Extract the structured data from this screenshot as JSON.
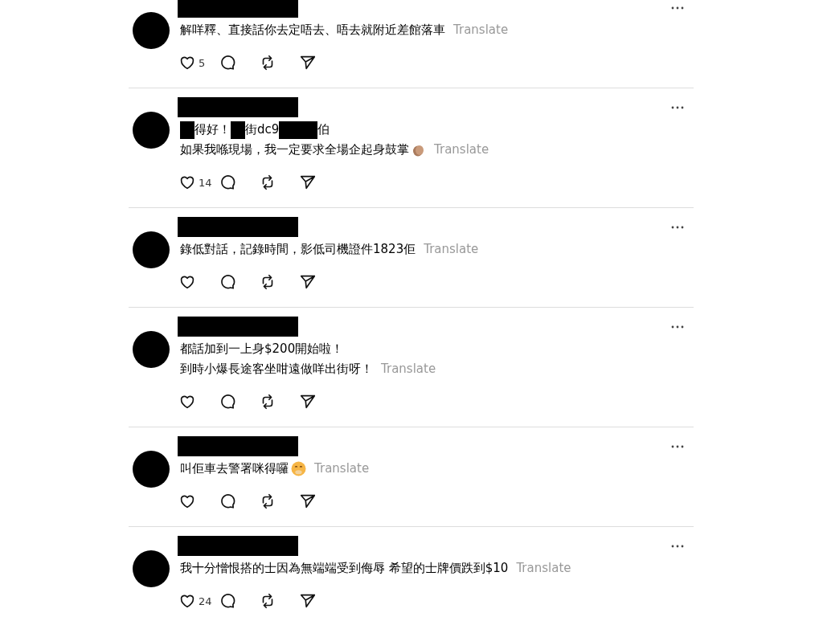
{
  "posts": [
    {
      "lines": [
        [
          {
            "kind": "text",
            "text": "解咩釋、直接話你去定唔去、唔去就附近差館落車"
          }
        ]
      ],
      "translate": "Translate",
      "likes": "5"
    },
    {
      "lines": [
        [
          {
            "kind": "redacted",
            "wide": false
          },
          {
            "kind": "text",
            "text": "得好！"
          },
          {
            "kind": "redacted",
            "wide": false
          },
          {
            "kind": "text",
            "text": "街dc9"
          },
          {
            "kind": "redacted",
            "wide": true
          },
          {
            "kind": "text",
            "text": "伯"
          }
        ],
        [
          {
            "kind": "text",
            "text": "如果我喺現場，我一定要求全場企起身鼓掌"
          },
          {
            "kind": "clap"
          }
        ]
      ],
      "translate": "Translate",
      "likes": "14"
    },
    {
      "lines": [
        [
          {
            "kind": "text",
            "text": "錄低對話，記錄時間，影低司機證件1823佢"
          }
        ]
      ],
      "translate": "Translate"
    },
    {
      "lines": [
        [
          {
            "kind": "text",
            "text": "都話加到一上身$200開始啦！"
          }
        ],
        [
          {
            "kind": "text",
            "text": "到時小爆長途客坐咁遠做咩出街呀！"
          }
        ]
      ],
      "translate": "Translate"
    },
    {
      "lines": [
        [
          {
            "kind": "text",
            "text": "叫佢車去警署咪得囉"
          },
          {
            "kind": "smile"
          }
        ]
      ],
      "translate": "Translate"
    },
    {
      "lines": [
        [
          {
            "kind": "text",
            "text": "我十分憎恨搭的士因為無端端受到侮辱 希望的士牌價跌到$10"
          }
        ]
      ],
      "translate": "Translate",
      "likes": "24"
    }
  ]
}
